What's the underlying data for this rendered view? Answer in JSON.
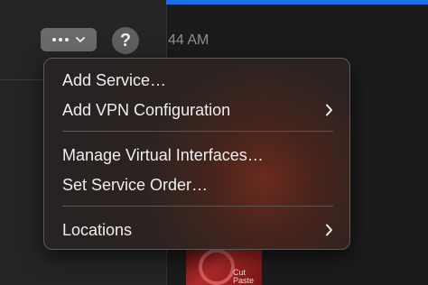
{
  "toolbar": {
    "more_button_chevron": "chevron-down-icon",
    "help_label": "?"
  },
  "background": {
    "time_fragment": "44 AM",
    "thumbnail_label_1": "Cut",
    "thumbnail_label_2": "Paste"
  },
  "menu": {
    "items": [
      {
        "label": "Add Service…",
        "submenu": false
      },
      {
        "label": "Add VPN Configuration",
        "submenu": true
      },
      {
        "label": "Manage Virtual Interfaces…",
        "submenu": false
      },
      {
        "label": "Set Service Order…",
        "submenu": false
      },
      {
        "label": "Locations",
        "submenu": true
      }
    ]
  },
  "colors": {
    "accent": "#1e6fe6",
    "menu_text": "#efefef"
  }
}
